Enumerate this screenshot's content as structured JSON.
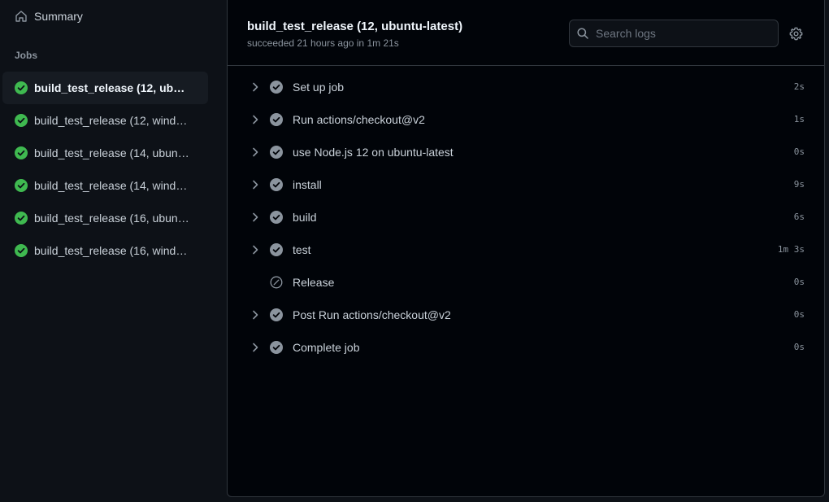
{
  "sidebar": {
    "summary_label": "Summary",
    "jobs_heading": "Jobs",
    "jobs": [
      {
        "label": "build_test_release (12, ubuntu-latest)",
        "active": true
      },
      {
        "label": "build_test_release (12, windows-latest)",
        "active": false
      },
      {
        "label": "build_test_release (14, ubuntu-latest)",
        "active": false
      },
      {
        "label": "build_test_release (14, windows-latest)",
        "active": false
      },
      {
        "label": "build_test_release (16, ubuntu-latest)",
        "active": false
      },
      {
        "label": "build_test_release (16, windows-latest)",
        "active": false
      }
    ]
  },
  "job": {
    "title": "build_test_release (12, ubuntu-latest)",
    "meta": "succeeded 21 hours ago in 1m 21s"
  },
  "search": {
    "placeholder": "Search logs"
  },
  "steps": [
    {
      "name": "Set up job",
      "duration": "2s",
      "status": "success",
      "expandable": true
    },
    {
      "name": "Run actions/checkout@v2",
      "duration": "1s",
      "status": "success",
      "expandable": true
    },
    {
      "name": "use Node.js 12 on ubuntu-latest",
      "duration": "0s",
      "status": "success",
      "expandable": true
    },
    {
      "name": "install",
      "duration": "9s",
      "status": "success",
      "expandable": true
    },
    {
      "name": "build",
      "duration": "6s",
      "status": "success",
      "expandable": true
    },
    {
      "name": "test",
      "duration": "1m 3s",
      "status": "success",
      "expandable": true
    },
    {
      "name": "Release",
      "duration": "0s",
      "status": "skipped",
      "expandable": false
    },
    {
      "name": "Post Run actions/checkout@v2",
      "duration": "0s",
      "status": "success",
      "expandable": true
    },
    {
      "name": "Complete job",
      "duration": "0s",
      "status": "success",
      "expandable": true
    }
  ],
  "colors": {
    "success": "#3fb950",
    "step_check": "#8b949e",
    "background": "#0d1117",
    "border": "#30363d"
  },
  "icons": {
    "summary": "home-icon",
    "job_status": "check-circle-fill-icon",
    "search": "search-icon",
    "settings": "gear-icon",
    "expand": "chevron-right-icon",
    "step_success": "check-circle-fill-icon",
    "step_skipped": "skip-icon"
  }
}
